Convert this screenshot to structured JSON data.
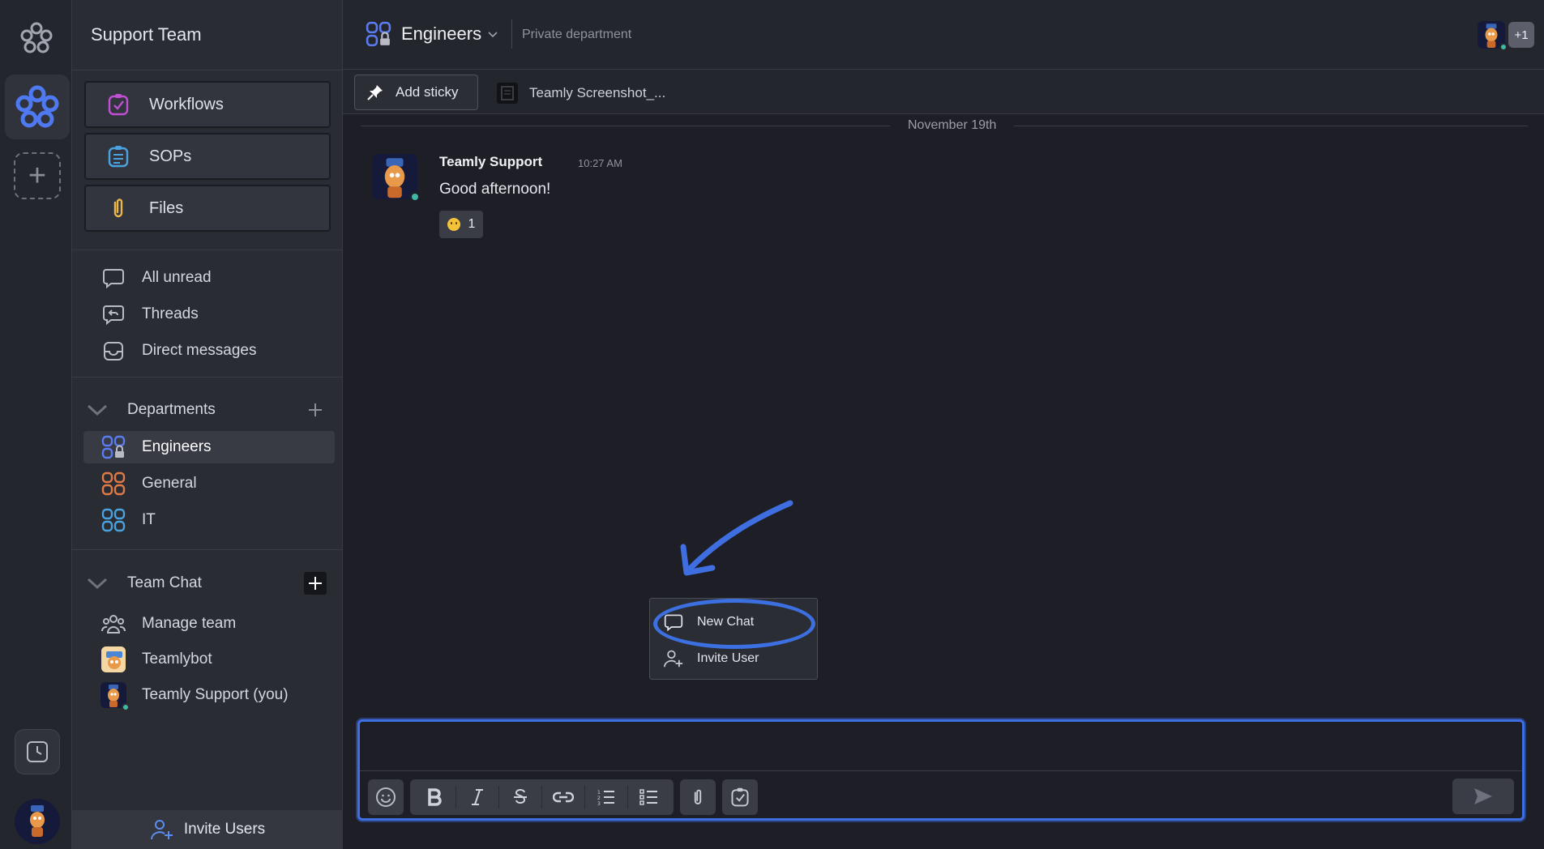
{
  "workspace": {
    "name": "Support Team"
  },
  "quick_links": [
    {
      "label": "Workflows",
      "icon": "workflow-icon",
      "color": "#c04fd6"
    },
    {
      "label": "SOPs",
      "icon": "sop-icon",
      "color": "#4aa3df"
    },
    {
      "label": "Files",
      "icon": "paperclip-icon",
      "color": "#e8b64a"
    }
  ],
  "nav": [
    {
      "label": "All unread",
      "icon": "chat-bubble-icon"
    },
    {
      "label": "Threads",
      "icon": "thread-icon"
    },
    {
      "label": "Direct messages",
      "icon": "inbox-icon"
    }
  ],
  "departments": {
    "label": "Departments",
    "items": [
      {
        "label": "Engineers",
        "color": "#5b7cf0",
        "locked": true,
        "active": true
      },
      {
        "label": "General",
        "color": "#e07b45",
        "locked": false,
        "active": false
      },
      {
        "label": "IT",
        "color": "#4aa3df",
        "locked": false,
        "active": false
      }
    ]
  },
  "team_chat": {
    "label": "Team Chat",
    "items": [
      {
        "label": "Manage team",
        "icon": "team-icon"
      },
      {
        "label": "Teamlybot",
        "icon": "bot-avatar"
      },
      {
        "label": "Teamly Support (you)",
        "icon": "user-avatar"
      }
    ]
  },
  "invite_users_label": "Invite Users",
  "channel": {
    "title": "Engineers",
    "subtitle": "Private department",
    "member_extra": "+1"
  },
  "sticky": {
    "add_label": "Add sticky",
    "file_label": "Teamly Screenshot_..."
  },
  "date_divider": "November 19th",
  "message": {
    "author": "Teamly Support",
    "time": "10:27 AM",
    "text": "Good afternoon!",
    "reaction_count": "1"
  },
  "dropdown": {
    "items": [
      {
        "label": "New Chat",
        "icon": "chat-bubble-icon"
      },
      {
        "label": "Invite User",
        "icon": "add-user-icon"
      }
    ]
  },
  "composer": {
    "placeholder": ""
  },
  "colors": {
    "accent": "#3e6ee0",
    "online": "#3fb8a6"
  }
}
